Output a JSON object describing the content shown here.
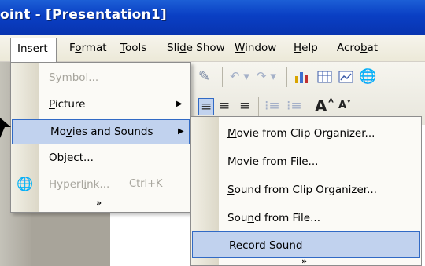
{
  "window": {
    "title": "oint - [Presentation1]"
  },
  "menubar": {
    "items": [
      {
        "label": "Insert",
        "accel": "I"
      },
      {
        "label": "Format",
        "accel": "o"
      },
      {
        "label": "Tools",
        "accel": "T"
      },
      {
        "label": "Slide Show",
        "accel": "d"
      },
      {
        "label": "Window",
        "accel": "W"
      },
      {
        "label": "Help",
        "accel": "H"
      },
      {
        "label": "Acrobat",
        "accel": "b"
      }
    ]
  },
  "insert_menu": {
    "items": [
      {
        "label": "Symbol...",
        "disabled": true
      },
      {
        "label": "Picture",
        "submenu": true
      },
      {
        "label": "Movies and Sounds",
        "submenu": true,
        "highlighted": true
      },
      {
        "label": "Object..."
      },
      {
        "label": "Hyperlink...",
        "shortcut": "Ctrl+K",
        "disabled": true,
        "icon": "hyperlink-globe-icon"
      }
    ],
    "more": "»"
  },
  "submenu": {
    "items": [
      {
        "label": "Movie from Clip Organizer..."
      },
      {
        "label": "Movie from File..."
      },
      {
        "label": "Sound from Clip Organizer..."
      },
      {
        "label": "Sound from File..."
      },
      {
        "label": "Record Sound",
        "highlighted": true
      }
    ],
    "more": "»"
  },
  "toolbar": {
    "icons": [
      "format-painter-icon",
      "undo-icon",
      "redo-icon",
      "insert-chart-icon",
      "insert-table-icon",
      "insert-chart-object-icon",
      "globe-icon"
    ],
    "formatting_icons": [
      "align-left-icon",
      "align-center-icon",
      "align-right-icon",
      "numbered-list-icon",
      "bullet-list-icon",
      "increase-font-icon",
      "decrease-font-icon"
    ]
  },
  "colors": {
    "titlebar": "#0a3fc4",
    "highlight_fill": "#c1d2ee",
    "highlight_border": "#316ac5"
  }
}
